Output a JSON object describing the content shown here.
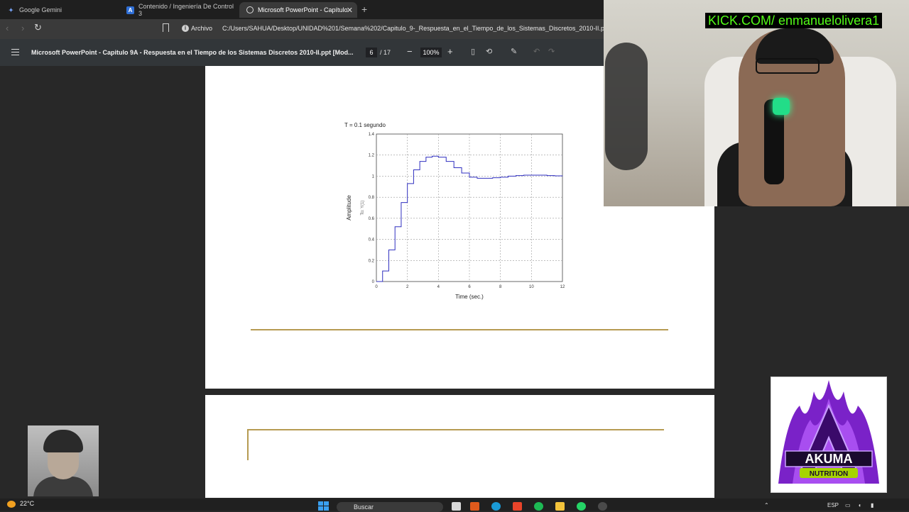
{
  "browser": {
    "tabs": [
      {
        "label": "Google Gemini",
        "icon": "gemini-icon"
      },
      {
        "label": "Contenido / Ingeniería De Control 3",
        "icon": "course-icon"
      },
      {
        "label": "Microsoft PowerPoint - Capítulo",
        "icon": "globe-icon",
        "active": true
      }
    ],
    "archivo_label": "Archivo",
    "url": "C:/Users/SAHUA/Desktop/UNIDAD%201/Semana%202/Capitulo_9-_Respuesta_en_el_Tiempo_de_los_Sistemas_Discretos_2010-II.ppt.pdf"
  },
  "pdf_toolbar": {
    "title": "Microsoft PowerPoint - Capitulo 9A - Respuesta en el Tiempo de los Sistemas Discretos 2010-II.ppt [Mod...",
    "page_current": "6",
    "page_total": "/ 17",
    "zoom": "100%",
    "minus_label": "−",
    "plus_label": "+"
  },
  "chart_data": {
    "type": "line",
    "title": "T = 0.1 segundo",
    "xlabel": "Time (sec.)",
    "ylabel": "Amplitude",
    "ylabel2": "To: Y(1)",
    "xlim": [
      0,
      12
    ],
    "ylim": [
      0,
      1.4
    ],
    "x_ticks": [
      "0",
      "2",
      "4",
      "6",
      "8",
      "10",
      "12"
    ],
    "y_ticks": [
      "0",
      "0.2",
      "0.4",
      "0.6",
      "0.8",
      "1",
      "1.2",
      "1.4"
    ],
    "grid": true,
    "series": [
      {
        "color": "#3030c0",
        "x": [
          0,
          0.4,
          0.8,
          1.2,
          1.6,
          2.0,
          2.4,
          2.8,
          3.2,
          3.6,
          4.0,
          4.5,
          5.0,
          5.5,
          6.0,
          6.5,
          7.0,
          7.5,
          8.0,
          8.5,
          9.0,
          9.5,
          10.0,
          10.5,
          11.0,
          11.5,
          12.0
        ],
        "values": [
          0,
          0.1,
          0.3,
          0.52,
          0.75,
          0.93,
          1.06,
          1.14,
          1.18,
          1.19,
          1.18,
          1.14,
          1.08,
          1.03,
          0.99,
          0.98,
          0.98,
          0.985,
          0.99,
          1.0,
          1.005,
          1.01,
          1.01,
          1.01,
          1.005,
          1.003,
          1.0
        ]
      }
    ]
  },
  "overlay": {
    "kick": "KICK.COM/ enmanuelolivera1",
    "brand_top": "AKUMA",
    "brand_bottom": "NUTRITION"
  },
  "taskbar": {
    "weather": "22°C",
    "search": "Buscar",
    "lang": "ESP"
  }
}
